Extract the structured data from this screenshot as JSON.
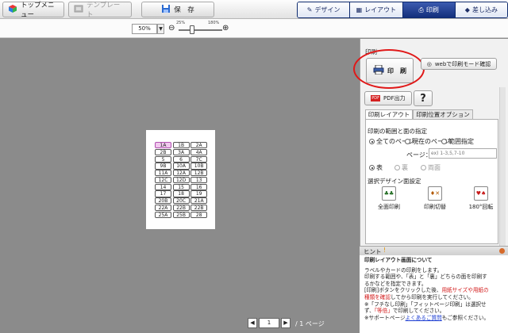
{
  "toolbar": {
    "top_menu": "トップメニュー",
    "template": "テンプレート",
    "save": "保　存",
    "tabs": [
      {
        "label": "デザイン"
      },
      {
        "label": "レイアウト"
      },
      {
        "label": "印刷"
      },
      {
        "label": "差し込み"
      }
    ]
  },
  "zoom": {
    "value": "50%",
    "tick_left": "25%",
    "tick_right": "180%",
    "level": 0.3
  },
  "canvas": {
    "cells": [
      "1A",
      "1B",
      "2A",
      "2B",
      "3A",
      "4A",
      "5",
      "6",
      "7C",
      "9B",
      "10A",
      "10B",
      "11A",
      "12A",
      "12B",
      "12C",
      "12D",
      "13",
      "14",
      "15",
      "16",
      "17",
      "18",
      "19",
      "20B",
      "20C",
      "21A",
      "22A",
      "22B",
      "22B",
      "25A",
      "25B",
      "28"
    ],
    "selected_index": 0
  },
  "pagenav": {
    "current": "1",
    "total": "/ 1 ページ"
  },
  "panel": {
    "section_title": "印刷",
    "print_button": "印　刷",
    "web_button": "webで印刷モード確認",
    "pdf_button": "PDF出力",
    "help_button": "?",
    "subtabs": [
      "印刷レイアウト",
      "印刷位置オプション"
    ],
    "range_title": "印刷の範囲と面の指定",
    "range_options": [
      "全てのページ",
      "現在のページ",
      "範囲指定"
    ],
    "page_label": "ページ：",
    "page_placeholder": "ex) 1-3,5,7-10",
    "side_options": [
      "表",
      "裏",
      "両面"
    ],
    "design_title": "選択デザイン面設定",
    "design_buttons": [
      "全面印刷",
      "印刷切替",
      "180°回転"
    ]
  },
  "hint": {
    "title": "ヒント",
    "heading": "印刷レイアウト画面について",
    "line1": "ラベルやカードの印刷をします。",
    "line2": "印刷する範囲や、「表」と「裏」どちらの面を印刷す",
    "line3": "るかなどを指定できます。",
    "line4a": "[印刷]ボタンをクリックした後、",
    "line4b": "用紙サイズや用紙の",
    "line5a": "種類を確認",
    "line5b": "してから印刷を実行してください。",
    "line6": "※「フチなし印刷」「フィットページ印刷」は選択せ",
    "line7a": "ず、",
    "line7b": "「等倍」",
    "line7c": "で印刷してください。",
    "line8a": "※サポートページ",
    "line8b": "よくあるご質問",
    "line8c": "もご参照ください。"
  }
}
